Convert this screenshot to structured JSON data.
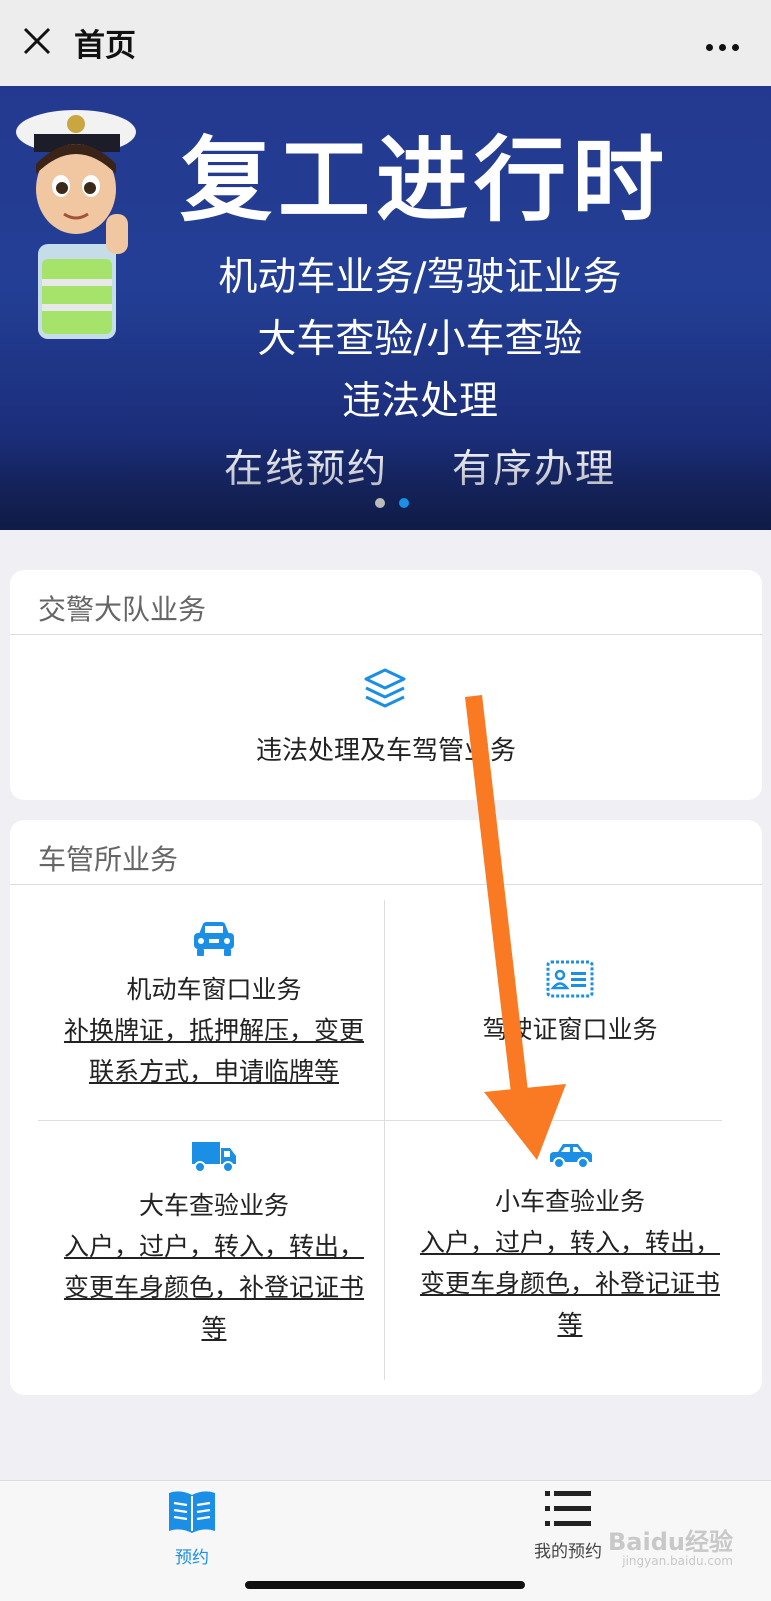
{
  "nav": {
    "title": "首页"
  },
  "banner": {
    "title": "复工进行时",
    "line1": "机动车业务/驾驶证业务",
    "line2": "大车查验/小车查验",
    "line3": "违法处理",
    "line4a": "在线预约",
    "line4b": "有序办理",
    "slide_count": 2,
    "active_slide": 2
  },
  "section1": {
    "title": "交警大队业务",
    "item": {
      "label": "违法处理及车驾管业务",
      "icon": "layers-icon"
    }
  },
  "section2": {
    "title": "车管所业务",
    "items": [
      {
        "name": "机动车窗口业务",
        "desc": "补换牌证，抵押解压，变更联系方式，申请临牌等",
        "icon": "car-front-icon"
      },
      {
        "name": "驾驶证窗口业务",
        "desc": "",
        "icon": "id-card-icon"
      },
      {
        "name": "大车查验业务",
        "desc": "入户，过户，转入，转出，变更车身颜色，补登记证书等",
        "icon": "truck-icon"
      },
      {
        "name": "小车查验业务",
        "desc": "入户，过户，转入，转出，变更车身颜色，补登记证书等",
        "icon": "car-side-icon"
      }
    ]
  },
  "tabbar": {
    "tabs": [
      {
        "label": "预约",
        "icon": "book-icon",
        "active": true
      },
      {
        "label": "我的预约",
        "icon": "list-icon",
        "active": false
      }
    ]
  },
  "watermark": {
    "text": "Baidu经验",
    "sub": "jingyan.baidu.com"
  },
  "colors": {
    "accent": "#1a8fe5",
    "arrow": "#f97a22",
    "banner": "#23398f"
  }
}
